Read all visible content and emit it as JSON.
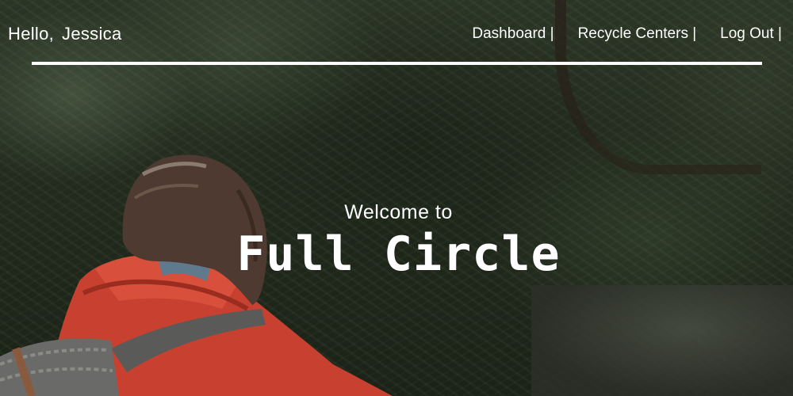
{
  "header": {
    "greeting": "Hello,",
    "user_name": "Jessica",
    "nav": [
      {
        "label": "Dashboard |"
      },
      {
        "label": "Recycle Centers |"
      },
      {
        "label": "Log Out |"
      }
    ]
  },
  "hero": {
    "welcome": "Welcome to",
    "brand": "Full Circle"
  }
}
